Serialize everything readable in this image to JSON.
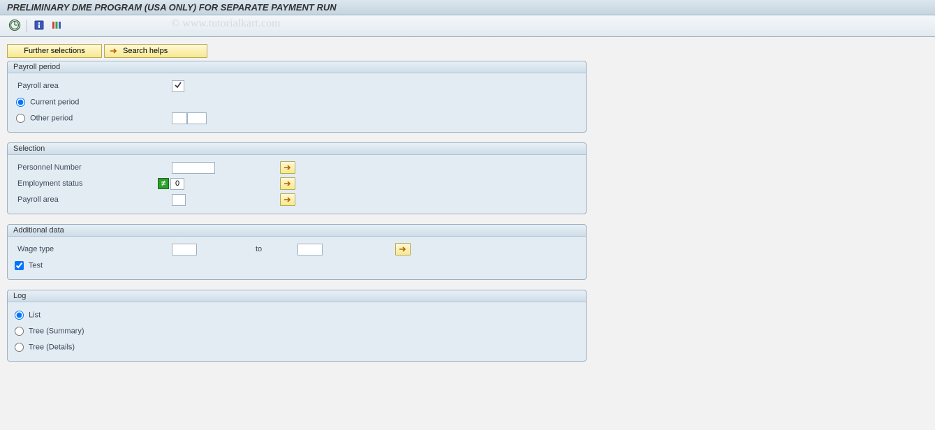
{
  "titlebar": {
    "title": "PRELIMINARY DME PROGRAM (USA ONLY) FOR SEPARATE PAYMENT RUN"
  },
  "watermark": "© www.tutorialkart.com",
  "toolbar": {
    "icons": [
      "execute-icon",
      "info-icon",
      "bars-icon"
    ]
  },
  "buttons": {
    "further_selections": "Further selections",
    "search_helps": "Search helps"
  },
  "groups": {
    "payroll_period": {
      "title": "Payroll period",
      "payroll_area_label": "Payroll area",
      "payroll_area_value": "",
      "current_period_label": "Current period",
      "current_period_checked": true,
      "other_period_label": "Other period",
      "other_period_checked": false,
      "other_period_from": "",
      "other_period_to": ""
    },
    "selection": {
      "title": "Selection",
      "personnel_number_label": "Personnel Number",
      "personnel_number_value": "",
      "employment_status_label": "Employment status",
      "employment_status_indicator": "≠",
      "employment_status_value": "0",
      "payroll_area_label": "Payroll area",
      "payroll_area_value": ""
    },
    "additional_data": {
      "title": "Additional data",
      "wage_type_label": "Wage type",
      "wage_type_from": "",
      "to_label": "to",
      "wage_type_to": "",
      "test_label": "Test",
      "test_checked": true
    },
    "log": {
      "title": "Log",
      "list_label": "List",
      "list_checked": true,
      "tree_summary_label": "Tree (Summary)",
      "tree_summary_checked": false,
      "tree_details_label": "Tree (Details)",
      "tree_details_checked": false
    }
  }
}
